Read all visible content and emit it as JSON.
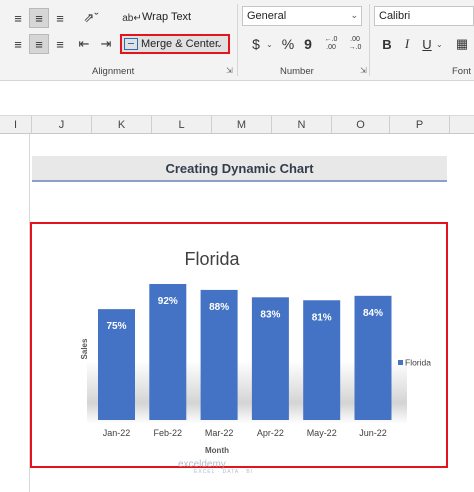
{
  "ribbon": {
    "alignment": {
      "wrap_text_label": "Wrap Text",
      "merge_center_label": "Merge & Center",
      "group_label": "Alignment"
    },
    "number": {
      "format_value": "General",
      "currency_symbol": "$",
      "percent_symbol": "%",
      "comma_symbol": "9",
      "increase_decimal": "←.0 .00",
      "decrease_decimal": ".00 →.0",
      "group_label": "Number"
    },
    "font": {
      "font_name": "Calibri",
      "bold": "B",
      "italic": "I",
      "underline": "U",
      "group_label": "Font"
    }
  },
  "sheet": {
    "columns": [
      "I",
      "J",
      "K",
      "L",
      "M",
      "N",
      "O",
      "P"
    ],
    "banner_title": "Creating Dynamic Chart"
  },
  "chart_data": {
    "type": "bar",
    "title": "Florida",
    "xlabel": "Month",
    "ylabel": "Sales",
    "categories": [
      "Jan-22",
      "Feb-22",
      "Mar-22",
      "Apr-22",
      "May-22",
      "Jun-22"
    ],
    "series": [
      {
        "name": "Florida",
        "values": [
          75,
          92,
          88,
          83,
          81,
          84
        ],
        "color": "#4472c4"
      }
    ],
    "value_labels": [
      "75%",
      "92%",
      "88%",
      "83%",
      "81%",
      "84%"
    ],
    "value_unit": "%",
    "legend_position": "right",
    "grid": false
  },
  "watermark": {
    "brand": "exceldemy",
    "tagline": "EXCEL · DATA · BI"
  },
  "colors": {
    "accent_red": "#e3141c",
    "bar_blue": "#4472c4",
    "ribbon_bg": "#f3f3f3"
  }
}
